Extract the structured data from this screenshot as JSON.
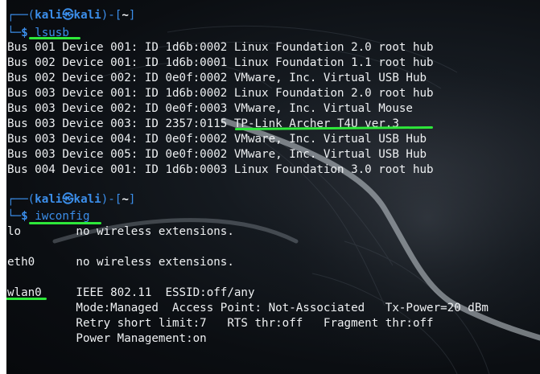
{
  "prompt": {
    "user": "kali",
    "symbol": "㉿",
    "host": "kali",
    "dir": "~",
    "dollar": "$"
  },
  "commands": {
    "first": "lsusb",
    "second": "iwconfig"
  },
  "lsusb_output": [
    "Bus 001 Device 001: ID 1d6b:0002 Linux Foundation 2.0 root hub",
    "Bus 002 Device 001: ID 1d6b:0001 Linux Foundation 1.1 root hub",
    "Bus 002 Device 002: ID 0e0f:0002 VMware, Inc. Virtual USB Hub",
    "Bus 003 Device 001: ID 1d6b:0002 Linux Foundation 2.0 root hub",
    "Bus 003 Device 002: ID 0e0f:0003 VMware, Inc. Virtual Mouse",
    "Bus 003 Device 003: ID 2357:0115 TP-Link Archer T4U ver.3",
    "Bus 003 Device 004: ID 0e0f:0002 VMware, Inc. Virtual USB Hub",
    "Bus 003 Device 005: ID 0e0f:0002 VMware, Inc. Virtual USB Hub",
    "Bus 004 Device 001: ID 1d6b:0003 Linux Foundation 3.0 root hub"
  ],
  "iwconfig_output": [
    "lo        no wireless extensions.",
    "",
    "eth0      no wireless extensions.",
    "",
    "wlan0     IEEE 802.11  ESSID:off/any",
    "          Mode:Managed  Access Point: Not-Associated   Tx-Power=20 dBm",
    "          Retry short limit:7   RTS thr:off   Fragment thr:off",
    "          Power Management:on"
  ],
  "colors": {
    "prompt_blue": "#3b8eea",
    "text": "#eef0f2",
    "highlight_green": "#2ee83a"
  }
}
